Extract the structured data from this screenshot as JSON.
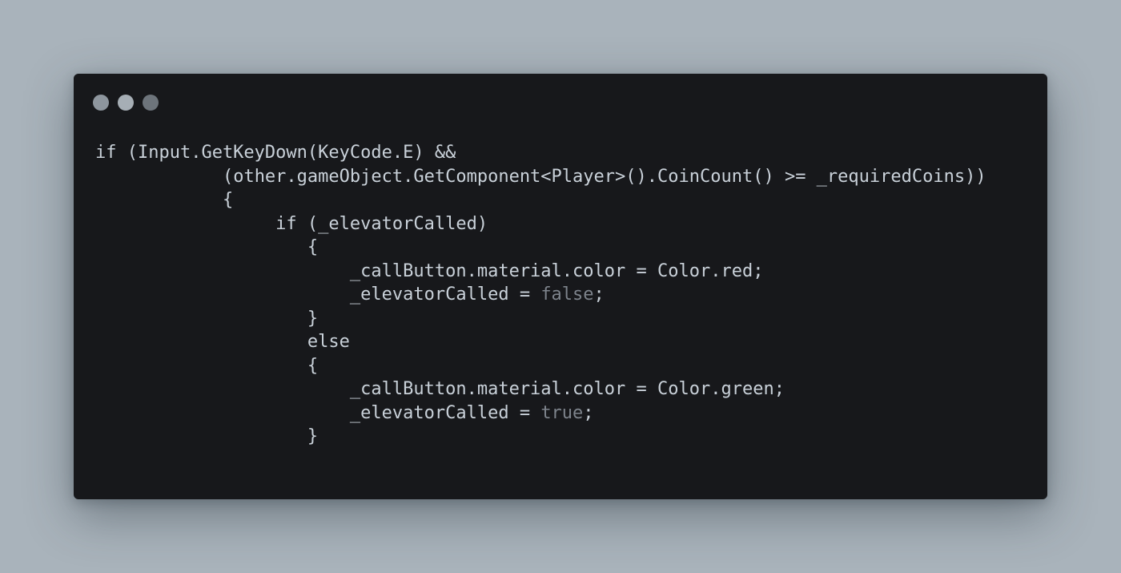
{
  "colors": {
    "background": "#a9b3bb",
    "window": "#17181b",
    "code_text": "#c9d1d9",
    "dim_keyword": "#7d838b",
    "dots": [
      "#8e969e",
      "#a6aeb5",
      "#6d747b"
    ]
  },
  "code": {
    "lines": [
      {
        "indent": "",
        "text": "if (Input.GetKeyDown(KeyCode.E) &&",
        "keyword": "",
        "tail": ""
      },
      {
        "indent": "            ",
        "text": "(other.gameObject.GetComponent<Player>().CoinCount() >= _requiredCoins))",
        "keyword": "",
        "tail": ""
      },
      {
        "indent": "            ",
        "text": "{",
        "keyword": "",
        "tail": ""
      },
      {
        "indent": "                 ",
        "text": "if (_elevatorCalled)",
        "keyword": "",
        "tail": ""
      },
      {
        "indent": "                    ",
        "text": "{",
        "keyword": "",
        "tail": ""
      },
      {
        "indent": "                        ",
        "text": "_callButton.material.color = Color.red;",
        "keyword": "",
        "tail": ""
      },
      {
        "indent": "                        ",
        "text": "_elevatorCalled = ",
        "keyword": "false",
        "tail": ";"
      },
      {
        "indent": "                    ",
        "text": "}",
        "keyword": "",
        "tail": ""
      },
      {
        "indent": "                    ",
        "text": "else",
        "keyword": "",
        "tail": ""
      },
      {
        "indent": "                    ",
        "text": "{",
        "keyword": "",
        "tail": ""
      },
      {
        "indent": "                        ",
        "text": "_callButton.material.color = Color.green;",
        "keyword": "",
        "tail": ""
      },
      {
        "indent": "                        ",
        "text": "_elevatorCalled = ",
        "keyword": "true",
        "tail": ";"
      },
      {
        "indent": "                    ",
        "text": "}",
        "keyword": "",
        "tail": ""
      }
    ]
  }
}
